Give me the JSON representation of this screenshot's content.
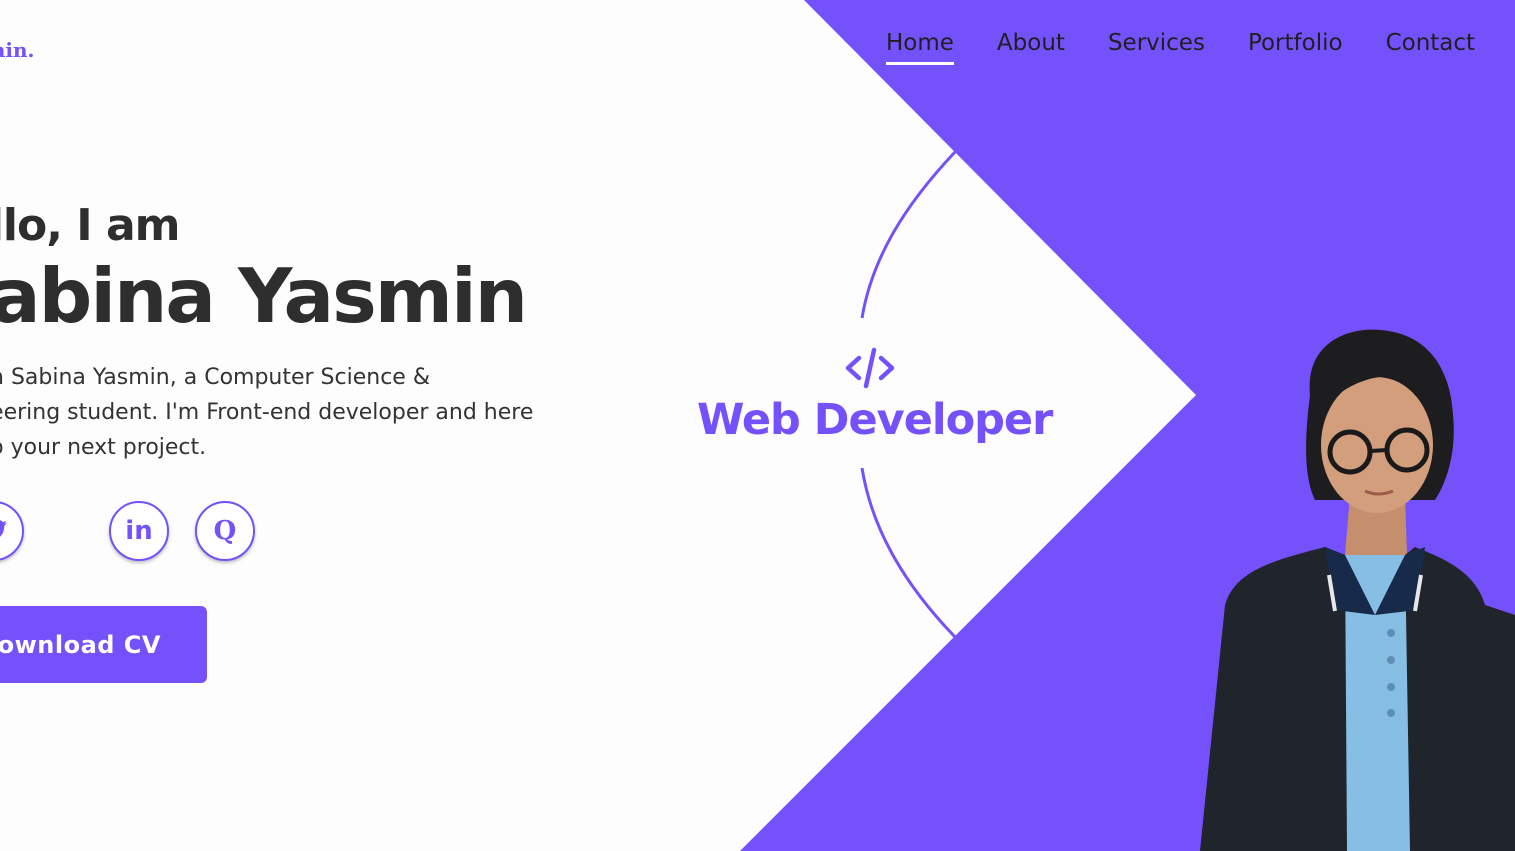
{
  "header": {
    "logo_text": "asmin.",
    "nav": [
      {
        "label": "Home",
        "active": true
      },
      {
        "label": "About",
        "active": false
      },
      {
        "label": "Services",
        "active": false
      },
      {
        "label": "Portfolio",
        "active": false
      },
      {
        "label": "Contact",
        "active": false
      }
    ]
  },
  "hero": {
    "greeting": "ello, I am",
    "name": "Sabina Yasmin",
    "intro_line1": "I'm Sabina Yasmin, a Computer Science &",
    "intro_line2": "ineering student. I'm Front-end developer and here",
    "intro_line3": "elp your next project.",
    "socials": [
      {
        "icon": "twitter-icon",
        "glyph": ""
      },
      {
        "icon": "linkedin-icon",
        "glyph": "in"
      },
      {
        "icon": "quora-icon",
        "glyph": "Q"
      }
    ],
    "cta_label": "Download CV"
  },
  "badge": {
    "icon": "code-icon",
    "role": "Web Developer"
  },
  "colors": {
    "accent": "#7551fb",
    "text": "#2e2e2e",
    "background": "#fdfdfd"
  }
}
